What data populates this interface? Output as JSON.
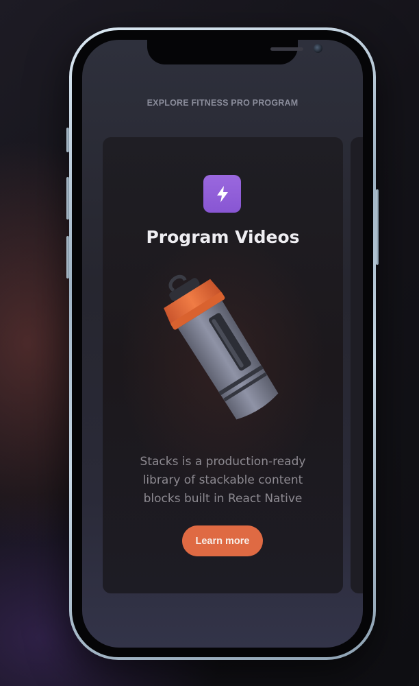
{
  "header": {
    "title": "EXPLORE FITNESS PRO PROGRAM"
  },
  "card": {
    "icon": "lightning-bolt-icon",
    "title": "Program Videos",
    "image": "shaker-bottle-illustration",
    "description": "Stacks is a production-ready library of stackable content blocks built in React Native",
    "button_label": "Learn more"
  },
  "colors": {
    "accent": "#df6a43",
    "icon_badge": "#9a68de",
    "card_background": "#1f1e24",
    "screen_background": "#2b2c37"
  }
}
